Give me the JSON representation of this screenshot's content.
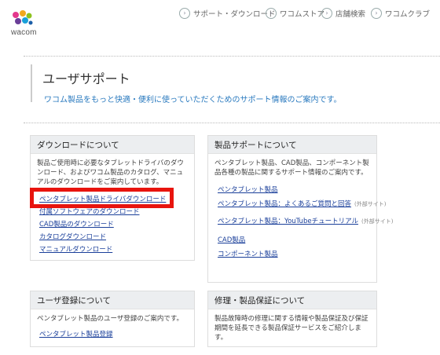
{
  "logo": {
    "text": "wacom"
  },
  "topnav": [
    {
      "label": "サポート・ダウンロード"
    },
    {
      "label": "ワコムストア"
    },
    {
      "label": "店舗検索"
    },
    {
      "label": "ワコムクラブ"
    }
  ],
  "header": {
    "title": "ユーザサポート",
    "subtitle": "ワコム製品をもっと快適・便利に使っていただくためのサポート情報のご案内です。"
  },
  "panels": {
    "download": {
      "title": "ダウンロードについて",
      "desc": "製品ご使用時に必要なタブレットドライバのダウンロード、およびワコム製品のカタログ、マニュアルのダウンロードをご案内しています。",
      "links": [
        "ペンタブレット製品ドライバダウンロード",
        "付属ソフトウェアのダウンロード",
        "CAD製品のダウンロード",
        "カタログダウンロード",
        "マニュアルダウンロード"
      ]
    },
    "product_support": {
      "title": "製品サポートについて",
      "desc": "ペンタブレット製品、CAD製品、コンポーネント製品各種の製品に関するサポート情報のご案内です。",
      "links": [
        {
          "label": "ペンタブレット製品",
          "ext": ""
        },
        {
          "label": "ペンタブレット製品：よくあるご質問と回答",
          "ext": "(外部サイト)"
        },
        {
          "label": "ペンタブレット製品：YouTubeチュートリアル",
          "ext": "(外部サイト)"
        },
        {
          "label": "CAD製品",
          "ext": ""
        },
        {
          "label": "コンポーネント製品",
          "ext": ""
        }
      ]
    },
    "user_reg": {
      "title": "ユーザ登録について",
      "desc": "ペンタブレット製品のユーザ登録のご案内です。",
      "links": [
        "ペンタブレット製品登録"
      ]
    },
    "repair": {
      "title": "修理・製品保証について",
      "desc": "製品故障時の修理に関する情報や製品保証及び保証期間を延長できる製品保証サービスをご紹介します。"
    }
  },
  "colors": {
    "highlight": "#e8140e",
    "link": "#1a3f9a",
    "subtitle": "#2a7abf"
  }
}
